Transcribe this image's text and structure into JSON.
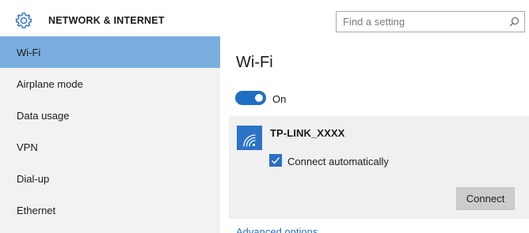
{
  "header": {
    "title": "NETWORK & INTERNET",
    "icon": "gear-icon",
    "search": {
      "placeholder": "Find a setting",
      "value": ""
    }
  },
  "sidebar": {
    "items": [
      {
        "label": "Wi-Fi",
        "selected": true
      },
      {
        "label": "Airplane mode",
        "selected": false
      },
      {
        "label": "Data usage",
        "selected": false
      },
      {
        "label": "VPN",
        "selected": false
      },
      {
        "label": "Dial-up",
        "selected": false
      },
      {
        "label": "Ethernet",
        "selected": false
      }
    ]
  },
  "main": {
    "title": "Wi-Fi",
    "wifi_toggle": {
      "state_label": "On",
      "on": true
    },
    "network": {
      "name": "TP-LINK_XXXX",
      "icon": "wifi-signal-icon",
      "connect_automatically": {
        "label": "Connect automatically",
        "checked": true
      },
      "connect_label": "Connect"
    },
    "advanced_options_label": "Advanced options"
  },
  "colors": {
    "accent": "#2b73c5",
    "sidebar_selected": "#7aaede",
    "sidebar_bg": "#f2f2f2",
    "card_bg": "#f0f0f0",
    "button_bg": "#cccccc"
  }
}
